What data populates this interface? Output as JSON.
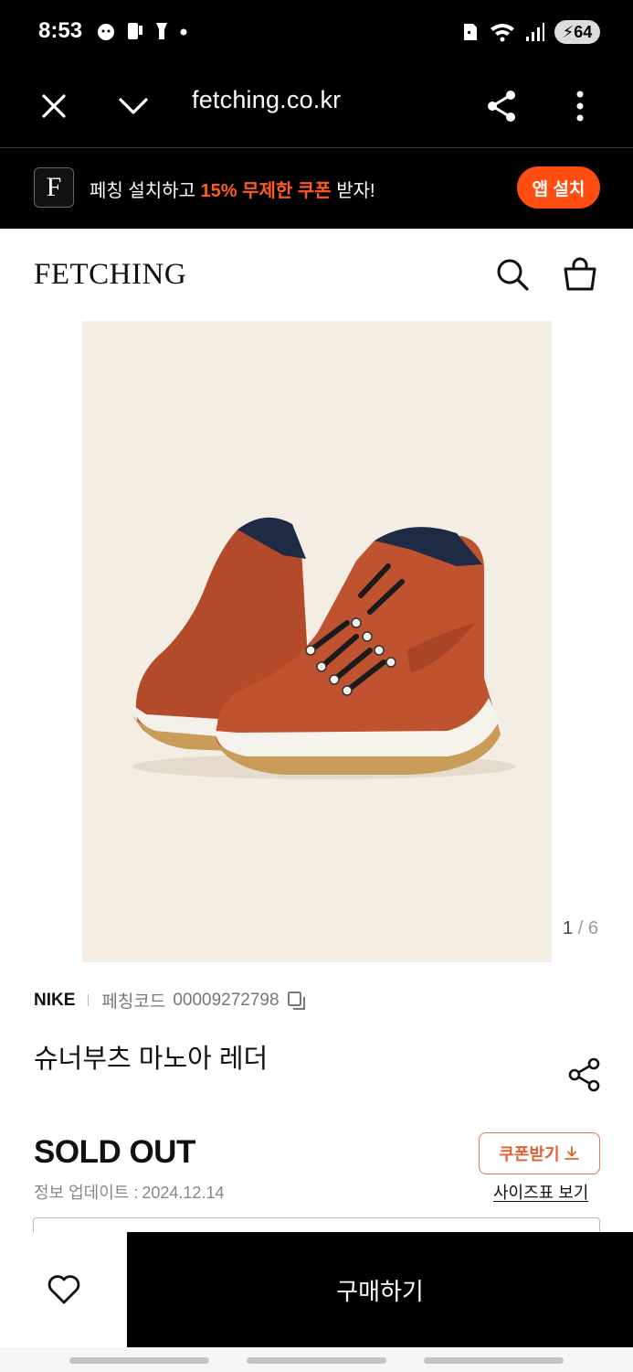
{
  "status_bar": {
    "time": "8:53",
    "battery": "64",
    "left_icons": [
      "face-notification-icon",
      "phone-notification-icon",
      "flashlight-icon",
      "dot-icon"
    ],
    "right_icons": [
      "sim-icon",
      "wifi-icon",
      "signal-icon",
      "battery-icon"
    ]
  },
  "browser": {
    "url": "fetching.co.kr",
    "icons": [
      "close-icon",
      "chevron-down-icon",
      "share-icon",
      "more-vertical-icon"
    ]
  },
  "promo": {
    "logo_letter": "F",
    "text_before": "페칭 설치하고 ",
    "text_highlight": "15% 무제한 쿠폰",
    "text_after": " 받자!",
    "install_label": "앱 설치",
    "accent_color": "#ff4d12"
  },
  "header": {
    "logo": "FETCHING",
    "icons": [
      "search-icon",
      "shopping-bag-icon"
    ]
  },
  "product": {
    "image_desc_icon": "boot-image",
    "pager_current": "1",
    "pager_sep": "/",
    "pager_total": "6",
    "brand": "NIKE",
    "code_label": "페칭코드",
    "code_value": "00009272798",
    "title": "슈너부츠 마노아 레더",
    "status": "SOLD OUT",
    "updated_label": "정보 업데이트 :",
    "updated_date": "2024.12.14",
    "coupon_label": "쿠폰받기",
    "size_chart_label": "사이즈표 보기"
  },
  "bottom": {
    "buy_label": "구매하기",
    "wish_icon": "heart-icon"
  }
}
